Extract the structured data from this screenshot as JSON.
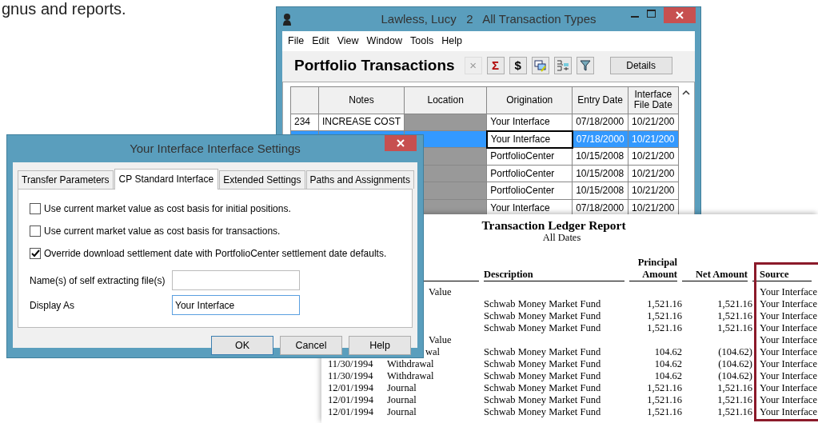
{
  "page_text": "gnus and reports.",
  "portfolio_window": {
    "title": "Lawless, Lucy   2   All Transaction Types",
    "menu": [
      "File",
      "Edit",
      "View",
      "Window",
      "Tools",
      "Help"
    ],
    "heading": "Portfolio Transactions",
    "toolbar": [
      {
        "kind": "glyph",
        "label": "×",
        "disabled": true,
        "color": "#999999"
      },
      {
        "kind": "glyph",
        "label": "Σ",
        "disabled": false,
        "color": "#b00000"
      },
      {
        "kind": "glyph",
        "label": "$",
        "disabled": false,
        "color": "#000000"
      },
      {
        "kind": "icon",
        "disabled": false
      },
      {
        "kind": "icon",
        "disabled": false
      },
      {
        "kind": "icon",
        "disabled": false
      }
    ],
    "details_button": "Details",
    "columns": [
      "Notes",
      "Location",
      "Origination",
      "Entry Date",
      "Interface File Date"
    ],
    "rows": [
      {
        "number": "234",
        "notes": "INCREASE COST",
        "origination": "Your Interface",
        "entry_date": "07/18/2000",
        "file_date": "10/21/200",
        "selected": false,
        "focused": false
      },
      {
        "origination": "Your Interface",
        "entry_date": "07/18/2000",
        "file_date": "10/21/200",
        "selected": true,
        "focused": true
      },
      {
        "origination": "PortfolioCenter",
        "entry_date": "10/15/2008",
        "file_date": "10/21/200",
        "selected": false,
        "focused": false
      },
      {
        "origination": "PortfolioCenter",
        "entry_date": "10/15/2008",
        "file_date": "10/21/200",
        "selected": false,
        "focused": false
      },
      {
        "origination": "PortfolioCenter",
        "entry_date": "10/15/2008",
        "file_date": "10/21/200",
        "selected": false,
        "focused": false
      },
      {
        "origination": "Your Interface",
        "entry_date": "07/18/2000",
        "file_date": "10/21/200",
        "selected": false,
        "focused": false
      }
    ]
  },
  "report": {
    "title": "Transaction Ledger Report",
    "subtitle": "All Dates",
    "columns": [
      {
        "label": "Description",
        "highlighted": false
      },
      {
        "label": "Principal Amount",
        "highlighted": false
      },
      {
        "label": "Net Amount",
        "highlighted": false
      },
      {
        "label": "Source",
        "highlighted": true
      }
    ],
    "rows": [
      {
        "kind": "group",
        "label": "Value",
        "source": "Your Interface"
      },
      {
        "kind": "entry",
        "description": "Schwab Money Market Fund",
        "principal": "1,521.16",
        "net": "1,521.16",
        "source": "Your Interface"
      },
      {
        "kind": "entry",
        "description": "Schwab Money Market Fund",
        "principal": "1,521.16",
        "net": "1,521.16",
        "source": "Your Interface"
      },
      {
        "kind": "entry",
        "description": "Schwab Money Market Fund",
        "principal": "1,521.16",
        "net": "1,521.16",
        "source": "Your Interface"
      },
      {
        "kind": "group",
        "label": "Value",
        "source": "Your Interface"
      },
      {
        "kind": "entry",
        "type": "wal",
        "description": "Schwab Money Market Fund",
        "principal": "104.62",
        "net": "(104.62)",
        "source": "Your Interface"
      },
      {
        "kind": "entry",
        "date": "11/30/1994",
        "type": "Withdrawal",
        "description": "Schwab Money Market Fund",
        "principal": "104.62",
        "net": "(104.62)",
        "source": "Your Interface"
      },
      {
        "kind": "entry",
        "date": "11/30/1994",
        "type": "Withdrawal",
        "description": "Schwab Money Market Fund",
        "principal": "104.62",
        "net": "(104.62)",
        "source": "Your Interface"
      },
      {
        "kind": "entry",
        "date": "12/01/1994",
        "type": "Journal",
        "description": "Schwab Money Market Fund",
        "principal": "1,521.16",
        "net": "1,521.16",
        "source": "Your Interface"
      },
      {
        "kind": "entry",
        "date": "12/01/1994",
        "type": "Journal",
        "description": "Schwab Money Market Fund",
        "principal": "1,521.16",
        "net": "1,521.16",
        "source": "Your Interface"
      },
      {
        "kind": "entry",
        "date": "12/01/1994",
        "type": "Journal",
        "description": "Schwab Money Market Fund",
        "principal": "1,521.16",
        "net": "1,521.16",
        "source": "Your Interface"
      }
    ]
  },
  "dialog": {
    "title": "Your Interface Interface Settings",
    "tabs": [
      {
        "label": "Transfer Parameters",
        "selected": false
      },
      {
        "label": "CP Standard Interface",
        "selected": true
      },
      {
        "label": "Extended Settings",
        "selected": false
      },
      {
        "label": "Paths and Assignments",
        "selected": false
      }
    ],
    "options": [
      {
        "label": "Use current market value as cost basis for initial positions.",
        "checked": false
      },
      {
        "label": "Use current market value as cost basis for transactions.",
        "checked": false
      },
      {
        "label": "Override download settlement date with PortfolioCenter settlement date defaults.",
        "checked": true
      }
    ],
    "fields": [
      {
        "label": "Name(s) of self extracting file(s)",
        "focused": false
      },
      {
        "label": "Display As",
        "value": "Your Interface",
        "focused": true
      }
    ],
    "buttons": [
      {
        "label": "OK",
        "default": true
      },
      {
        "label": "Cancel",
        "default": false
      },
      {
        "label": "Help",
        "default": false
      }
    ]
  }
}
